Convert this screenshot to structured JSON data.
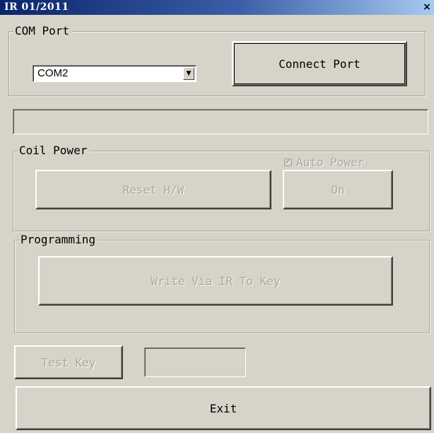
{
  "window": {
    "title": "IR  01/2011",
    "close_glyph": "×"
  },
  "com_port": {
    "group_label": "COM Port",
    "selected_port": "COM2",
    "dropdown_glyph": "▼",
    "connect_button": "Connect Port"
  },
  "status_bar": {
    "text": ""
  },
  "coil_power": {
    "group_label": "Coil Power",
    "reset_button": "Reset H/W",
    "auto_power_label": "Auto Power",
    "auto_power_checked": true,
    "check_glyph": "✔",
    "on_button": "On"
  },
  "programming": {
    "group_label": "Programming",
    "write_button": "Write  Via  IR  To Key"
  },
  "test": {
    "test_key_button": "Test Key",
    "result_text": ""
  },
  "exit_button": "Exit",
  "colors": {
    "face": "#d8d3c9",
    "title_start": "#0a246a",
    "title_end": "#a6caf0",
    "disabled_text": "#aaa69f"
  }
}
